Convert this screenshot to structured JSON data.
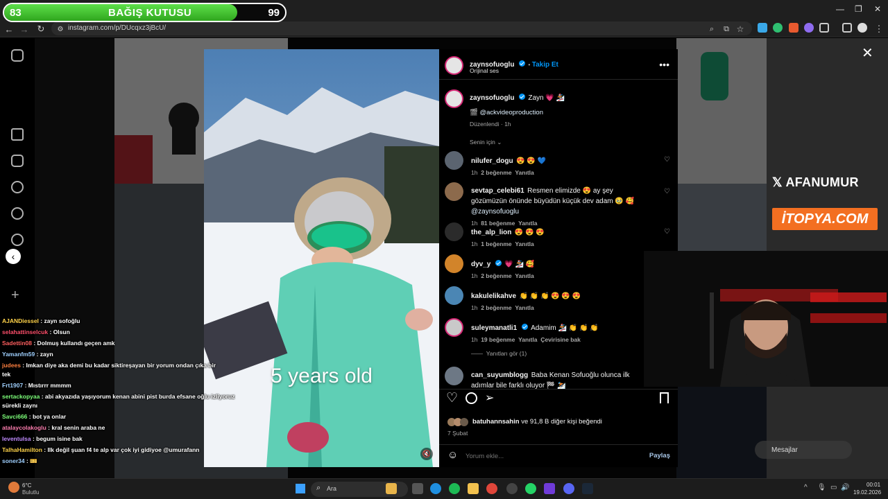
{
  "donation": {
    "left_value": "83",
    "title": "BAĞIŞ KUTUSU",
    "right_value": "99",
    "progress_percent": 83
  },
  "browser": {
    "url": "instagram.com/p/DUcqxz3jBcU/"
  },
  "post": {
    "author": "zaynsofuoglu",
    "follow_label": "Takip Et",
    "audio": "Orijinal ses",
    "caption_text": "Zayn 💗 🏂",
    "credit": "@ackvideoproduction",
    "edited": "Düzenlendi · 1h",
    "sort_label": "Senin için",
    "video_caption": "5 years old"
  },
  "comments": [
    {
      "user": "nilufer_dogu",
      "text": "😍 😍 💙",
      "time": "1h",
      "likes": "2 beğenme",
      "reply": "Yanıtla"
    },
    {
      "user": "sevtap_celebi61",
      "text": "Resmen elimizde 😍 ay şey gözümüzün önünde büyüdün küçük dev adam 🥹 🥰 ",
      "mention": "@zaynsofuoglu",
      "time": "1h",
      "likes": "81 beğenme",
      "reply": "Yanıtla"
    },
    {
      "user": "the_alp_lion",
      "text": "😍 😍 😍",
      "time": "1h",
      "likes": "1 beğenme",
      "reply": "Yanıtla"
    },
    {
      "user": "dyv_y",
      "text": "💗 🏂 🥰",
      "time": "1h",
      "likes": "2 beğenme",
      "reply": "Yanıtla"
    },
    {
      "user": "kakulelikahve",
      "text": "👏 👏 👏 😍 😍 😍",
      "time": "1h",
      "likes": "2 beğenme",
      "reply": "Yanıtla"
    },
    {
      "user": "suleymanatli1",
      "text": "Adamim 🏂 👏 👏 👏",
      "time": "1h",
      "likes": "19 beğenme",
      "reply": "Yanıtla",
      "translate": "Çevirisine bak"
    },
    {
      "user": "can_suyumblogg",
      "text": "Baba Kenan Sofuoğlu olunca ilk adımlar bile farklı oluyor 🏁 ⛷️"
    }
  ],
  "see_replies": "Yanıtları gör (1)",
  "likes_line": {
    "user": "batuhannsahin",
    "rest": " ve 91,8 B diğer kişi beğendi"
  },
  "post_date": "7 Şubat",
  "add_comment_placeholder": "Yorum ekle...",
  "share_label": "Paylaş",
  "stream_overlays": {
    "brand_x": "AFANUMUR",
    "sponsor": "İTOPYA.COM"
  },
  "messages_label": "Mesajlar",
  "chat": [
    {
      "user": "AJANDiessel",
      "msg": " : zayn sofoğlu",
      "color": "#ffd34a"
    },
    {
      "user": "selahattinselcuk",
      "msg": " : Olsun",
      "color": "#ff4f6b"
    },
    {
      "user": "Sadettin08",
      "msg": " : Dolmuş kullandı geçen amk",
      "color": "#ff5f5f"
    },
    {
      "user": "Yamanfm59",
      "msg": " : zayn",
      "color": "#9fd0ff"
    },
    {
      "user": "judees",
      "msg": " : Imkan diye aka demi bu kadar siktireşayan bir yorum ondan çıka bir",
      "color": "#ff7f3f"
    },
    {
      "user": "",
      "msg": "tek",
      "color": "#fff"
    },
    {
      "user": "Frt1907",
      "msg": " : Mıstırrr mmmm",
      "color": "#9fd0ff"
    },
    {
      "user": "sertackopyaa",
      "msg": " : abi akyazıda yaşıyorum kenan abini pist burda efsane oğlu izliyoruz",
      "color": "#7dff7a"
    },
    {
      "user": "",
      "msg": "sürekli zaynı",
      "color": "#fff"
    },
    {
      "user": "Savci666",
      "msg": " : bot ya onlar",
      "color": "#7dff7a"
    },
    {
      "user": "atalaycolakoglu",
      "msg": " : kral senin araba ne",
      "color": "#ff7fb0"
    },
    {
      "user": "leventulsa",
      "msg": " : begum isine bak",
      "color": "#c08bff"
    },
    {
      "user": "TalhaHamilton",
      "msg": " : Ilk değil şuan f4 te alp var çok iyi gidiyoe @umurafann",
      "color": "#ffd34a"
    },
    {
      "user": "soner34",
      "msg": " : 🎫",
      "color": "#9fd0ff"
    }
  ],
  "taskbar": {
    "weather_temp": "6°C",
    "weather_desc": "Bulutlu",
    "search": "Ara",
    "time": "00:01",
    "date": "19.02.2026"
  }
}
